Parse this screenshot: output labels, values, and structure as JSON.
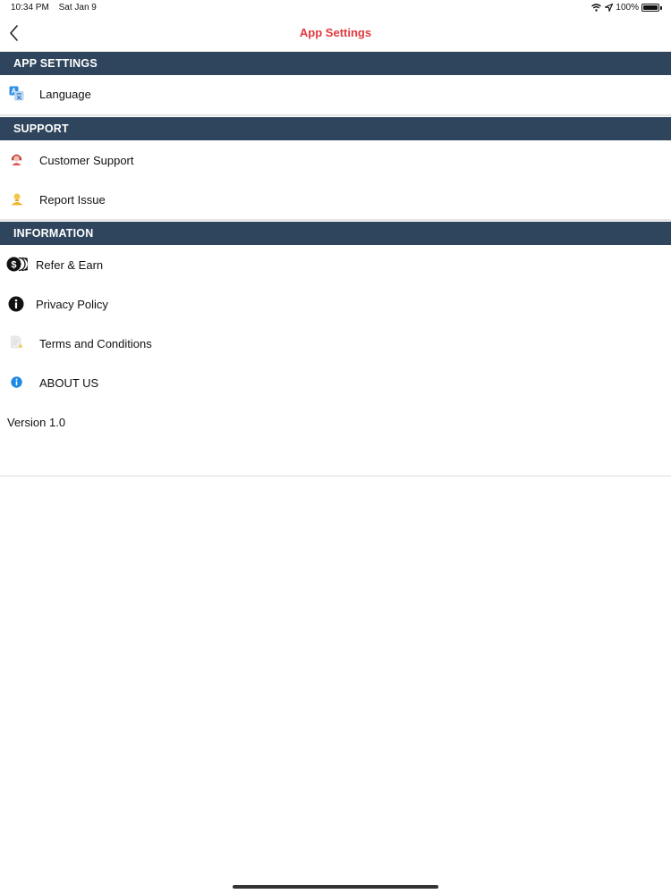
{
  "status_bar": {
    "time": "10:34 PM",
    "date": "Sat Jan 9",
    "battery": "100%"
  },
  "nav": {
    "title": "App Settings"
  },
  "sections": {
    "app_settings": {
      "header": "APP SETTINGS",
      "items": [
        {
          "label": "Language",
          "icon": "translate-icon"
        }
      ]
    },
    "support": {
      "header": "SUPPORT",
      "items": [
        {
          "label": "Customer Support",
          "icon": "customer-support-icon"
        },
        {
          "label": "Report Issue",
          "icon": "report-issue-icon"
        }
      ]
    },
    "information": {
      "header": "INFORMATION",
      "items": [
        {
          "label": "Refer & Earn",
          "icon": "coins-icon"
        },
        {
          "label": "Privacy Policy",
          "icon": "info-circle-icon"
        },
        {
          "label": "Terms and Conditions",
          "icon": "document-icon"
        },
        {
          "label": "ABOUT US",
          "icon": "about-info-icon"
        }
      ]
    }
  },
  "version": "Version 1.0",
  "colors": {
    "accent": "#e0393e",
    "section_header_bg": "#2f455d"
  }
}
